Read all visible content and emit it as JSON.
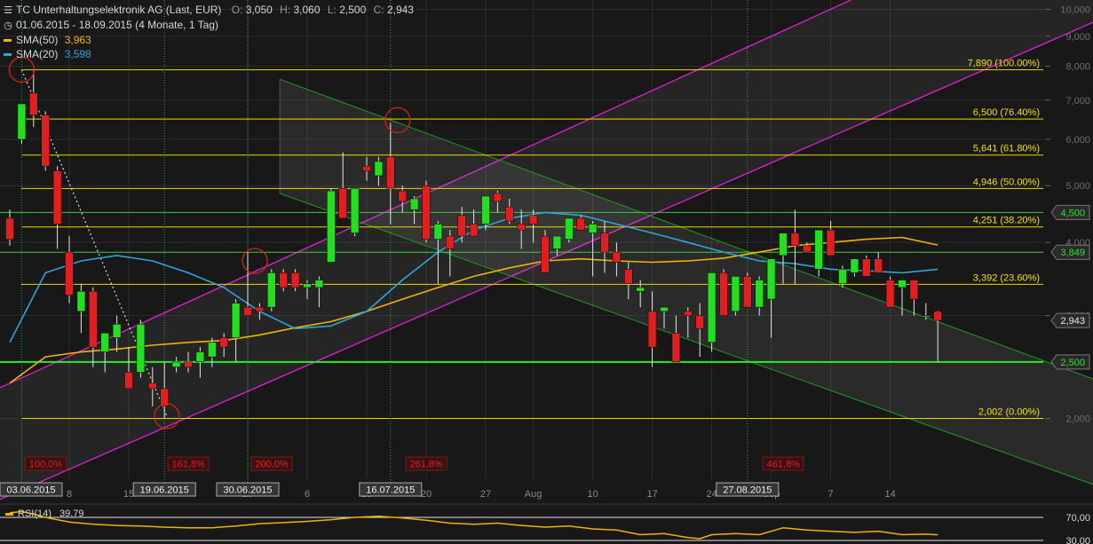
{
  "header": {
    "title": "TC Unterhaltungselektronik AG (Last, EUR)",
    "ohlc": [
      {
        "k": "O:",
        "v": "3,050"
      },
      {
        "k": "H:",
        "v": "3,060"
      },
      {
        "k": "L:",
        "v": "2,500"
      },
      {
        "k": "C:",
        "v": "2,943"
      }
    ],
    "period": "01.06.2015 - 18.09.2015 (4 Monate, 1 Tag)",
    "sma50": {
      "name": "SMA(50)",
      "value": "3,963",
      "color": "#f0b400"
    },
    "sma20": {
      "name": "SMA(20)",
      "value": "3,598",
      "color": "#2fa4d8"
    },
    "title_icon": "bar-chart-icon",
    "period_icon": "clock-icon"
  },
  "chart_data": {
    "type": "candlestick",
    "y_scale": "log",
    "ylim": [
      1.75,
      10.2
    ],
    "y_ticks": [
      {
        "v": 10,
        "label": "10,000"
      },
      {
        "v": 9,
        "label": "9,000"
      },
      {
        "v": 8,
        "label": "8,000"
      },
      {
        "v": 7,
        "label": "7,000"
      },
      {
        "v": 6,
        "label": "6,000"
      },
      {
        "v": 5,
        "label": "5,000"
      },
      {
        "v": 4,
        "label": "4,000"
      },
      {
        "v": 3,
        "label": "3,000"
      },
      {
        "v": 2,
        "label": "2,000"
      }
    ],
    "x_ticks": [
      {
        "i": 5,
        "label": "8"
      },
      {
        "i": 10,
        "label": "15"
      },
      {
        "i": 20,
        "label": "29"
      },
      {
        "i": 25,
        "label": "6"
      },
      {
        "i": 30,
        "label": "13"
      },
      {
        "i": 35,
        "label": "20"
      },
      {
        "i": 40,
        "label": "27"
      },
      {
        "i": 44,
        "label": "Aug"
      },
      {
        "i": 49,
        "label": "10"
      },
      {
        "i": 54,
        "label": "17"
      },
      {
        "i": 59,
        "label": "24"
      },
      {
        "i": 64,
        "label": "Sep"
      },
      {
        "i": 69,
        "label": "7"
      },
      {
        "i": 74,
        "label": "14"
      }
    ],
    "date_markers": [
      {
        "i": 1,
        "label": "03.06.2015"
      },
      {
        "i": 13,
        "label": "19.06.2015"
      },
      {
        "i": 20,
        "label": "30.06.2015"
      },
      {
        "i": 32,
        "label": "16.07.2015"
      },
      {
        "i": 62,
        "label": "27.08.2015"
      }
    ],
    "fib_levels": [
      {
        "v": 7.89,
        "label": "7,890 (100.00%)"
      },
      {
        "v": 6.5,
        "label": "6,500 (76.40%)"
      },
      {
        "v": 5.641,
        "label": "5,641 (61.80%)"
      },
      {
        "v": 4.946,
        "label": "4,946 (50.00%)"
      },
      {
        "v": 4.251,
        "label": "4,251 (38.20%)"
      },
      {
        "v": 3.392,
        "label": "3,392 (23.60%)"
      },
      {
        "v": 2.002,
        "label": "2,002 (0.00%)"
      }
    ],
    "horizontal_lines": [
      {
        "v": 4.5,
        "label": "4,500"
      },
      {
        "v": 3.849,
        "label": "3,849"
      },
      {
        "v": 2.5,
        "label": "2,500"
      }
    ],
    "last_price": {
      "v": 2.943,
      "label": "2,943"
    },
    "ext_labels": [
      "100,0%",
      "161,8%",
      "200,0%",
      "261,8%",
      "461,8%"
    ],
    "candles": [
      [
        4.4,
        4.55,
        3.95,
        4.05
      ],
      [
        6.0,
        6.9,
        5.9,
        6.9
      ],
      [
        7.2,
        7.89,
        6.3,
        6.6
      ],
      [
        6.6,
        6.7,
        5.3,
        5.4
      ],
      [
        5.3,
        5.4,
        3.9,
        4.3
      ],
      [
        3.85,
        4.1,
        3.15,
        3.25
      ],
      [
        3.05,
        3.4,
        2.8,
        3.3
      ],
      [
        3.3,
        3.35,
        2.45,
        2.65
      ],
      [
        2.6,
        2.8,
        2.4,
        2.8
      ],
      [
        2.75,
        3.0,
        2.6,
        2.9
      ],
      [
        2.4,
        2.65,
        2.25,
        2.25
      ],
      [
        2.4,
        2.95,
        2.35,
        2.9
      ],
      [
        2.3,
        2.45,
        2.1,
        2.25
      ],
      [
        2.25,
        2.5,
        2.0,
        2.1
      ],
      [
        2.45,
        2.55,
        2.4,
        2.5
      ],
      [
        2.5,
        2.6,
        2.4,
        2.45
      ],
      [
        2.5,
        2.65,
        2.35,
        2.6
      ],
      [
        2.55,
        2.75,
        2.45,
        2.7
      ],
      [
        2.75,
        2.8,
        2.55,
        2.65
      ],
      [
        2.75,
        3.2,
        2.5,
        3.15
      ],
      [
        3.1,
        3.85,
        3.05,
        3.0
      ],
      [
        3.1,
        3.15,
        2.95,
        3.05
      ],
      [
        3.1,
        3.6,
        3.05,
        3.55
      ],
      [
        3.55,
        3.6,
        3.3,
        3.35
      ],
      [
        3.55,
        3.6,
        3.3,
        3.35
      ],
      [
        3.35,
        3.45,
        3.2,
        3.4
      ],
      [
        3.35,
        3.5,
        3.1,
        3.45
      ],
      [
        3.7,
        4.95,
        3.7,
        4.9
      ],
      [
        4.95,
        5.7,
        4.4,
        4.4
      ],
      [
        4.15,
        4.95,
        4.1,
        4.95
      ],
      [
        5.4,
        5.6,
        5.1,
        5.3
      ],
      [
        5.2,
        5.6,
        5.0,
        5.5
      ],
      [
        5.6,
        6.4,
        4.3,
        4.95
      ],
      [
        4.9,
        5.0,
        4.5,
        4.7
      ],
      [
        4.55,
        4.8,
        4.3,
        4.75
      ],
      [
        5.0,
        5.1,
        4.0,
        4.05
      ],
      [
        4.05,
        4.35,
        3.4,
        4.3
      ],
      [
        4.1,
        4.2,
        3.5,
        3.9
      ],
      [
        4.45,
        4.6,
        4.0,
        4.1
      ],
      [
        4.3,
        4.55,
        4.1,
        4.1
      ],
      [
        4.3,
        4.8,
        4.2,
        4.8
      ],
      [
        4.85,
        4.9,
        4.5,
        4.7
      ],
      [
        4.6,
        4.75,
        4.3,
        4.35
      ],
      [
        4.3,
        4.55,
        3.9,
        4.2
      ],
      [
        4.45,
        4.55,
        4.0,
        4.3
      ],
      [
        4.1,
        4.2,
        3.55,
        3.55
      ],
      [
        3.9,
        4.1,
        3.8,
        4.1
      ],
      [
        4.05,
        4.4,
        4.0,
        4.4
      ],
      [
        4.4,
        4.45,
        4.2,
        4.2
      ],
      [
        4.15,
        4.35,
        3.5,
        4.3
      ],
      [
        4.15,
        4.35,
        3.55,
        3.85
      ],
      [
        3.85,
        4.0,
        3.5,
        3.7
      ],
      [
        3.6,
        3.7,
        3.2,
        3.4
      ],
      [
        3.3,
        3.45,
        3.1,
        3.35
      ],
      [
        3.05,
        3.3,
        2.45,
        2.65
      ],
      [
        3.05,
        3.1,
        2.85,
        3.1
      ],
      [
        2.8,
        3.0,
        2.5,
        2.5
      ],
      [
        3.05,
        3.1,
        2.75,
        3.0
      ],
      [
        3.0,
        3.15,
        2.55,
        2.85
      ],
      [
        2.7,
        3.25,
        2.6,
        3.55
      ],
      [
        3.55,
        3.6,
        3.0,
        3.0
      ],
      [
        3.05,
        3.5,
        3.0,
        3.5
      ],
      [
        3.5,
        3.55,
        3.1,
        3.1
      ],
      [
        3.1,
        3.5,
        3.0,
        3.45
      ],
      [
        3.2,
        3.25,
        2.75,
        3.75
      ],
      [
        3.8,
        3.9,
        3.4,
        4.15
      ],
      [
        4.15,
        4.55,
        3.4,
        3.95
      ],
      [
        3.95,
        4.0,
        3.85,
        3.85
      ],
      [
        3.6,
        4.1,
        3.5,
        4.2
      ],
      [
        4.2,
        4.35,
        3.8,
        3.8
      ],
      [
        3.4,
        3.65,
        3.35,
        3.6
      ],
      [
        3.55,
        3.75,
        3.5,
        3.75
      ],
      [
        3.75,
        3.8,
        3.5,
        3.5
      ],
      [
        3.75,
        3.85,
        3.55,
        3.55
      ],
      [
        3.45,
        3.5,
        3.1,
        3.1
      ],
      [
        3.35,
        3.45,
        3.0,
        3.45
      ],
      [
        3.45,
        3.45,
        3.0,
        3.2
      ],
      [
        3.0,
        3.15,
        2.95,
        3.0
      ],
      [
        3.05,
        3.06,
        2.5,
        2.943
      ]
    ],
    "sma50": [
      [
        0,
        2.3
      ],
      [
        3,
        2.55
      ],
      [
        6,
        2.6
      ],
      [
        9,
        2.63
      ],
      [
        12,
        2.67
      ],
      [
        15,
        2.7
      ],
      [
        18,
        2.72
      ],
      [
        21,
        2.78
      ],
      [
        24,
        2.86
      ],
      [
        27,
        2.93
      ],
      [
        30,
        3.05
      ],
      [
        33,
        3.2
      ],
      [
        36,
        3.35
      ],
      [
        39,
        3.5
      ],
      [
        42,
        3.62
      ],
      [
        45,
        3.72
      ],
      [
        48,
        3.75
      ],
      [
        51,
        3.72
      ],
      [
        54,
        3.7
      ],
      [
        57,
        3.72
      ],
      [
        60,
        3.76
      ],
      [
        63,
        3.85
      ],
      [
        66,
        3.95
      ],
      [
        69,
        4.0
      ],
      [
        72,
        4.05
      ],
      [
        75,
        4.08
      ],
      [
        78,
        3.96
      ]
    ],
    "sma20": [
      [
        0,
        2.7
      ],
      [
        3,
        3.55
      ],
      [
        6,
        3.72
      ],
      [
        9,
        3.8
      ],
      [
        12,
        3.72
      ],
      [
        15,
        3.55
      ],
      [
        18,
        3.35
      ],
      [
        21,
        3.05
      ],
      [
        24,
        2.85
      ],
      [
        27,
        2.88
      ],
      [
        30,
        3.05
      ],
      [
        33,
        3.45
      ],
      [
        36,
        3.85
      ],
      [
        39,
        4.2
      ],
      [
        42,
        4.4
      ],
      [
        45,
        4.5
      ],
      [
        48,
        4.45
      ],
      [
        51,
        4.3
      ],
      [
        54,
        4.15
      ],
      [
        57,
        4.0
      ],
      [
        60,
        3.85
      ],
      [
        63,
        3.72
      ],
      [
        66,
        3.68
      ],
      [
        69,
        3.6
      ],
      [
        72,
        3.58
      ],
      [
        75,
        3.55
      ],
      [
        78,
        3.6
      ]
    ],
    "rsi": {
      "name": "RSI(14)",
      "value": "39,79",
      "levels": [
        {
          "v": 70,
          "label": "70,00"
        },
        {
          "v": 30,
          "label": "30,00"
        }
      ],
      "values": [
        [
          0,
          78
        ],
        [
          1,
          80
        ],
        [
          2,
          76
        ],
        [
          3,
          70
        ],
        [
          5,
          62
        ],
        [
          7,
          58
        ],
        [
          9,
          56
        ],
        [
          11,
          55
        ],
        [
          13,
          53
        ],
        [
          15,
          52
        ],
        [
          17,
          52
        ],
        [
          19,
          55
        ],
        [
          21,
          59
        ],
        [
          23,
          61
        ],
        [
          25,
          63
        ],
        [
          27,
          66
        ],
        [
          29,
          70
        ],
        [
          31,
          72
        ],
        [
          33,
          69
        ],
        [
          35,
          65
        ],
        [
          37,
          60
        ],
        [
          39,
          58
        ],
        [
          41,
          60
        ],
        [
          43,
          56
        ],
        [
          45,
          53
        ],
        [
          47,
          55
        ],
        [
          49,
          50
        ],
        [
          51,
          48
        ],
        [
          53,
          40
        ],
        [
          55,
          42
        ],
        [
          57,
          35
        ],
        [
          58,
          33
        ],
        [
          59,
          40
        ],
        [
          61,
          42
        ],
        [
          63,
          40
        ],
        [
          65,
          52
        ],
        [
          67,
          48
        ],
        [
          69,
          46
        ],
        [
          71,
          44
        ],
        [
          73,
          46
        ],
        [
          75,
          40
        ],
        [
          77,
          41
        ],
        [
          78,
          39.79
        ]
      ]
    }
  },
  "colors": {
    "background": "#181818",
    "grid": "#2c2c2c",
    "up": "#22e020",
    "down": "#e02020",
    "fib": "#e8d800",
    "fib_label": "#f0e000",
    "hline": "#3acb3a",
    "support": "#2ee82e",
    "channel_up": "#e020d0",
    "channel_down": "#1e9a1e",
    "vline": "#3a9a6a",
    "circle": "#d42020",
    "ext_label": "#e02020"
  }
}
